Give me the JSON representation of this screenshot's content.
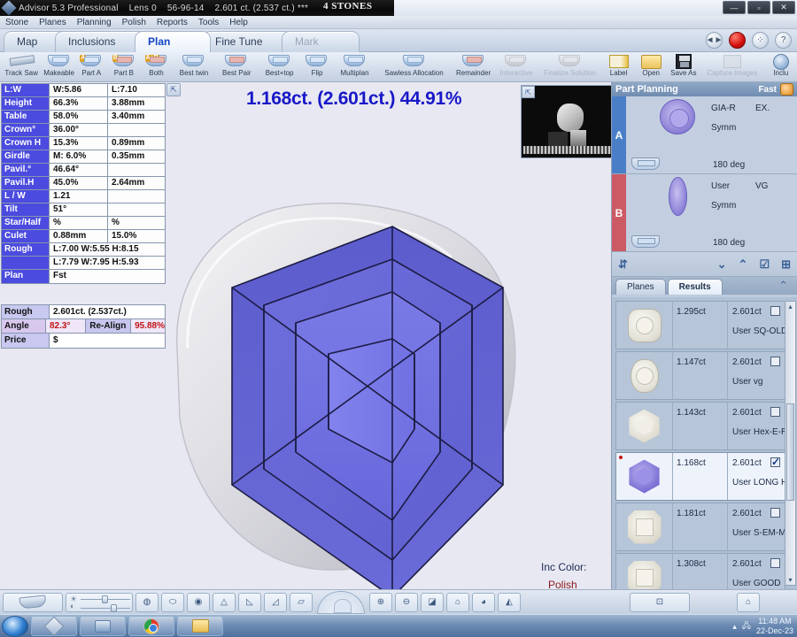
{
  "titlebar": {
    "app": "Advisor 5.3 Professional",
    "lens": "Lens 0",
    "code": "56-96-14",
    "weights": "2.601 ct. (2.537 ct.) ***",
    "center_title": "4 STONES",
    "min": "—",
    "max": "▫",
    "close": "✕"
  },
  "menu": [
    "Stone",
    "Planes",
    "Planning",
    "Polish",
    "Reports",
    "Tools",
    "Help"
  ],
  "tabs": [
    {
      "label": "Map",
      "state": "normal"
    },
    {
      "label": "Inclusions",
      "state": "normal"
    },
    {
      "label": "Plan",
      "state": "active"
    },
    {
      "label": "Fine Tune",
      "state": "normal"
    },
    {
      "label": "Mark",
      "state": "disabled"
    }
  ],
  "tabrow_buttons": {
    "nav": "◄►",
    "record": "record-button",
    "grid": "⁘",
    "help": "?"
  },
  "toolbar": [
    {
      "label": "Track Saw",
      "icon": "saw-icon",
      "disabled": false
    },
    {
      "label": "Makeable",
      "icon": "gem-icon",
      "disabled": false
    },
    {
      "label": "Part A",
      "icon": "gem-a-icon",
      "disabled": false
    },
    {
      "label": "Part B",
      "icon": "gem-b-icon",
      "disabled": false
    },
    {
      "label": "Both",
      "icon": "gem-ab-icon",
      "disabled": false
    },
    {
      "label": "Best twin",
      "icon": "twin-icon",
      "disabled": false
    },
    {
      "label": "Best Pair",
      "icon": "pair-icon",
      "disabled": false
    },
    {
      "label": "Best+top",
      "icon": "besttop-icon",
      "disabled": false
    },
    {
      "label": "Flip",
      "icon": "flip-icon",
      "disabled": false
    },
    {
      "label": "Multiplan",
      "icon": "multiplan-icon",
      "disabled": false
    },
    {
      "label": "Sawless Allocation",
      "icon": "sawless-icon",
      "disabled": false
    },
    {
      "label": "Remainder",
      "icon": "remainder-icon",
      "disabled": false
    },
    {
      "label": "Interactive",
      "icon": "interactive-icon",
      "disabled": true
    },
    {
      "label": "Finalize Solution",
      "icon": "finalize-icon",
      "disabled": true
    },
    {
      "label": "Label",
      "icon": "label-icon",
      "disabled": false
    },
    {
      "label": "Open",
      "icon": "folder-icon",
      "disabled": false
    },
    {
      "label": "Save As",
      "icon": "save-icon",
      "disabled": false
    },
    {
      "label": "Capture Images",
      "icon": "camera-icon",
      "disabled": true
    },
    {
      "label": "Inclu",
      "icon": "inclusion-icon",
      "disabled": false
    }
  ],
  "param_table": [
    {
      "key": "L:W",
      "v1": "W:5.86",
      "v2": "L:7.10"
    },
    {
      "key": "Height",
      "v1": "66.3%",
      "v2": "3.88mm"
    },
    {
      "key": "Table",
      "v1": "58.0%",
      "v2": "3.40mm"
    },
    {
      "key": "Crown°",
      "v1": "36.00°",
      "v2": ""
    },
    {
      "key": "Crown H",
      "v1": "15.3%",
      "v2": "0.89mm"
    },
    {
      "key": "Girdle",
      "v1": "M: 6.0%",
      "v2": "0.35mm"
    },
    {
      "key": "Pavil.°",
      "v1": "46.64°",
      "v2": ""
    },
    {
      "key": "Pavil.H",
      "v1": "45.0%",
      "v2": "2.64mm"
    },
    {
      "key": "L / W",
      "v1": "1.21",
      "v2": ""
    },
    {
      "key": "Tilt",
      "v1": "51°",
      "v2": ""
    },
    {
      "key": "Star/Half",
      "v1": "%",
      "v2": "%"
    },
    {
      "key": "Culet",
      "v1": "0.88mm",
      "v2": "15.0%"
    }
  ],
  "param_wide": [
    {
      "key": "Rough",
      "value": "L:7.00 W:5.55 H:8.15"
    },
    {
      "key": "",
      "value": "L:7.79 W:7.95 H:5.93"
    },
    {
      "key": "Plan",
      "value": "Fst"
    }
  ],
  "small_table": {
    "rough_key": "Rough",
    "rough_value": "2.601ct. (2.537ct.)",
    "angle_key": "Angle",
    "angle_value": "82.3°",
    "realign_label": "Re-Align",
    "realign_value": "95.88%",
    "price_key": "Price",
    "price_value": "$"
  },
  "viewport": {
    "main_title": "1.168ct. (2.601ct.) 44.91%",
    "inc_color_label": "Inc Color:",
    "inc_color_value": "Polish"
  },
  "part_planning": {
    "header": "Part Planning",
    "fast": "Fast",
    "slots": [
      {
        "badge": "A",
        "shape": "round-brilliant",
        "cut": "GIA-R",
        "grade": "EX.",
        "symm": "Symm",
        "deg": "180 deg"
      },
      {
        "badge": "B",
        "shape": "marquise",
        "cut": "User",
        "grade": "VG",
        "symm": "Symm",
        "deg": "180 deg"
      }
    ]
  },
  "sort_icons": [
    "sort-az-icon",
    "chevron-down-icon",
    "chevron-up-icon",
    "check-list-icon",
    "arrange-icon"
  ],
  "panel_tabs": [
    {
      "label": "Planes",
      "active": false
    },
    {
      "label": "Results",
      "active": true
    }
  ],
  "results": [
    {
      "carat": "1.295ct",
      "rough": "2.601ct",
      "name": "User SQ-OLD",
      "shape": "cushion",
      "checked": false,
      "selected": false
    },
    {
      "carat": "1.147ct",
      "rough": "2.601ct",
      "name": "User vg",
      "shape": "oval",
      "checked": false,
      "selected": false
    },
    {
      "carat": "1.143ct",
      "rough": "2.601ct",
      "name": "User Hex-E-RF",
      "shape": "hexagon",
      "checked": false,
      "selected": false
    },
    {
      "carat": "1.168ct",
      "rough": "2.601ct",
      "name": "User LONG HE",
      "shape": "hexagon-selected",
      "checked": true,
      "selected": true
    },
    {
      "carat": "1.181ct",
      "rough": "2.601ct",
      "name": "User S-EM-MU",
      "shape": "emerald",
      "checked": false,
      "selected": false
    },
    {
      "carat": "1.308ct",
      "rough": "2.601ct",
      "name": "User GOOD",
      "shape": "emerald",
      "checked": false,
      "selected": false
    }
  ],
  "bottom_bar": {
    "buttons": [
      "view-gem-icon",
      "brightness-slider",
      "gauge-icon",
      "ellipse-icon",
      "globe-icon",
      "facet-icon",
      "crown-icon",
      "pavilion-icon",
      "ruler-icon",
      "nav-dial",
      "zoom-in-icon",
      "zoom-out-icon",
      "shade-icon",
      "outline-icon",
      "color-icon",
      "highlight-icon",
      "measure-icon",
      "home-icon"
    ]
  },
  "taskbar": {
    "start": "start-orb",
    "items": [
      "diamond-app-icon",
      "printer-icon",
      "chrome-icon",
      "folder-icon"
    ],
    "tray_up": "▴",
    "tray_net": "network-icon",
    "time": "11:48 AM",
    "date": "22-Dec-23"
  }
}
